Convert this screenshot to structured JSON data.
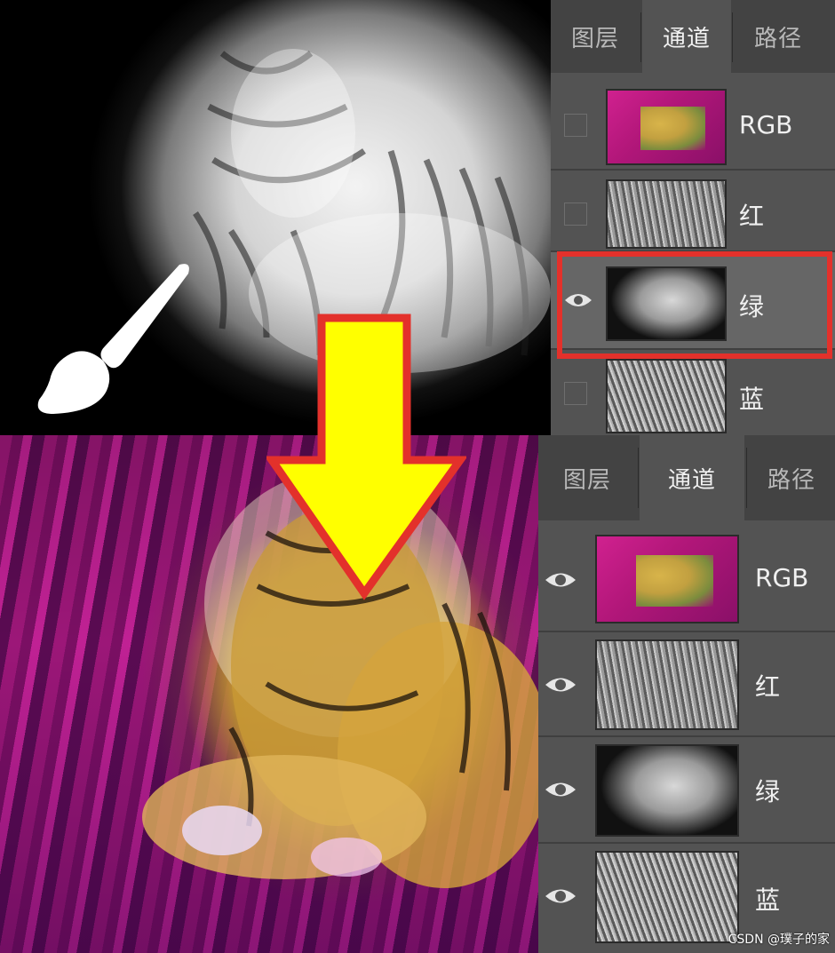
{
  "top_panel": {
    "tabs": [
      "图层",
      "通道",
      "路径"
    ],
    "active_tab": 1,
    "channels": [
      {
        "label": "RGB",
        "visible": false,
        "thumb": "rgb"
      },
      {
        "label": "红",
        "visible": false,
        "thumb": "red"
      },
      {
        "label": "绿",
        "visible": true,
        "thumb": "green",
        "highlighted": true
      },
      {
        "label": "蓝",
        "visible": false,
        "thumb": "blue"
      }
    ]
  },
  "bottom_panel": {
    "tabs": [
      "图层",
      "通道",
      "路径"
    ],
    "active_tab": 1,
    "channels": [
      {
        "label": "RGB",
        "visible": true,
        "thumb": "rgb"
      },
      {
        "label": "红",
        "visible": true,
        "thumb": "red"
      },
      {
        "label": "绿",
        "visible": true,
        "thumb": "green"
      },
      {
        "label": "蓝",
        "visible": true,
        "thumb": "blue"
      }
    ]
  },
  "icons": {
    "brush": "paintbrush-icon",
    "arrow": "down-arrow",
    "eye": "eye-icon"
  },
  "colors": {
    "panel_bg": "#535353",
    "tab_bar_bg": "#434343",
    "highlight": "#e3312b",
    "arrow_fill": "#ffff00",
    "arrow_stroke": "#e3312b"
  },
  "watermark": "CSDN @璞子的家"
}
